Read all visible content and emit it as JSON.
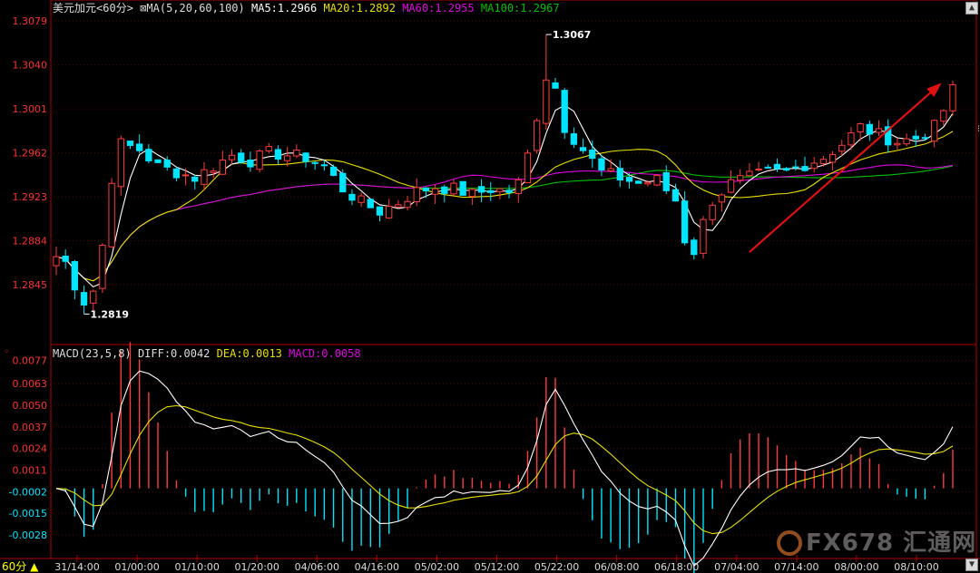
{
  "header": {
    "symbol": "美元加元",
    "period": "<60分>",
    "ma_title": "MA(5,20,60,100)",
    "ma5": "MA5:1.2966",
    "ma20": "MA20:1.2892",
    "ma60": "MA60:1.2955",
    "ma100": "MA100:1.2967"
  },
  "macd_header": {
    "title": "MACD(23,5,8)",
    "diff": "DIFF:0.0042",
    "dea": "DEA:0.0013",
    "macd": "MACD:0.0058"
  },
  "period_tab": "60分",
  "watermark": "FX678 汇通网",
  "colors": {
    "up": "#ff3b3b",
    "down": "#00e5ff",
    "ma5": "#ffffff",
    "ma20": "#e8e000",
    "ma60": "#e000e0",
    "ma100": "#00c000",
    "axis": "#c00000",
    "arrow": "#e01010"
  },
  "chart_data": [
    {
      "type": "candlestick",
      "title": "美元加元<60分>",
      "y_ticks": [
        1.2845,
        1.2884,
        1.2923,
        1.2962,
        1.3001,
        1.304,
        1.3079
      ],
      "ylim": [
        1.28,
        1.3088
      ],
      "x_tick_labels": [
        "31/14:00",
        "01/00:00",
        "01/10:00",
        "01/20:00",
        "04/06:00",
        "04/16:00",
        "05/02:00",
        "05/12:00",
        "05/22:00",
        "06/08:00",
        "06/18:00",
        "07/04:00",
        "07/14:00",
        "08/00:00",
        "08/10:00"
      ],
      "annotations": [
        {
          "text": "1.3067",
          "price": 1.3067,
          "kind": "high"
        },
        {
          "text": "1.2819",
          "price": 1.2819,
          "kind": "low"
        }
      ],
      "trend_arrow": {
        "from_price": 1.2874,
        "to_price": 1.3022,
        "direction": "up"
      },
      "anchors": [
        [
          0,
          1.287
        ],
        [
          1,
          1.2865
        ],
        [
          2,
          1.2845
        ],
        [
          3,
          1.283
        ],
        [
          4,
          1.284
        ],
        [
          5,
          1.288
        ],
        [
          6,
          1.294
        ],
        [
          7,
          1.297
        ],
        [
          9,
          1.2965
        ],
        [
          11,
          1.295
        ],
        [
          13,
          1.2945
        ],
        [
          15,
          1.294
        ],
        [
          17,
          1.295
        ],
        [
          19,
          1.296
        ],
        [
          21,
          1.2955
        ],
        [
          23,
          1.2962
        ],
        [
          25,
          1.296
        ],
        [
          27,
          1.2958
        ],
        [
          29,
          1.295
        ],
        [
          31,
          1.293
        ],
        [
          33,
          1.2918
        ],
        [
          35,
          1.291
        ],
        [
          37,
          1.2918
        ],
        [
          39,
          1.2928
        ],
        [
          41,
          1.2932
        ],
        [
          43,
          1.293
        ],
        [
          45,
          1.2925
        ],
        [
          47,
          1.293
        ],
        [
          49,
          1.2928
        ],
        [
          50,
          1.2935
        ],
        [
          51,
          1.296
        ],
        [
          52,
          1.2995
        ],
        [
          53,
          1.303
        ],
        [
          54,
          1.302
        ],
        [
          55,
          1.2985
        ],
        [
          57,
          1.2965
        ],
        [
          59,
          1.2945
        ],
        [
          61,
          1.294
        ],
        [
          63,
          1.2935
        ],
        [
          65,
          1.2938
        ],
        [
          67,
          1.292
        ],
        [
          68,
          1.2885
        ],
        [
          69,
          1.2875
        ],
        [
          70,
          1.29
        ],
        [
          71,
          1.292
        ],
        [
          73,
          1.2935
        ],
        [
          75,
          1.294
        ],
        [
          77,
          1.2945
        ],
        [
          79,
          1.2945
        ],
        [
          81,
          1.2952
        ],
        [
          83,
          1.2958
        ],
        [
          85,
          1.297
        ],
        [
          87,
          1.2985
        ],
        [
          89,
          1.2978
        ],
        [
          91,
          1.2972
        ],
        [
          93,
          1.2975
        ],
        [
          95,
          1.2985
        ],
        [
          96,
          1.3
        ],
        [
          97,
          1.3018
        ]
      ],
      "series": [
        {
          "name": "MA5",
          "value": 1.2966
        },
        {
          "name": "MA20",
          "value": 1.2892
        },
        {
          "name": "MA60",
          "value": 1.2955
        },
        {
          "name": "MA100",
          "value": 1.2967
        }
      ]
    },
    {
      "type": "bar+line",
      "title": "MACD(23,5,8)",
      "y_ticks": [
        -0.0028,
        -0.0015,
        -0.0002,
        0.0011,
        0.0024,
        0.0037,
        0.005,
        0.0063,
        0.0077
      ],
      "ylim": [
        -0.004,
        0.008
      ],
      "series": [
        {
          "name": "DIFF",
          "value": 0.0042
        },
        {
          "name": "DEA",
          "value": 0.0013
        },
        {
          "name": "MACD",
          "value": 0.0058
        }
      ]
    }
  ]
}
